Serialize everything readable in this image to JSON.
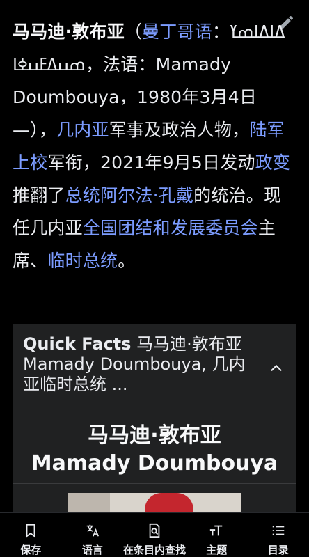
{
  "article": {
    "title": "马马迪·敦布亚",
    "p_open_paren": "（",
    "link_mandinka": "曼丁哥语",
    "p_mandinka_text": "：ߡߊߡߊߘߌ ߘߎߡߓߎߦߊ，法语：Mamady Doumbouya，1980年3月4日—），",
    "link_guinea": "几内亚",
    "p_text2": "军事及政治人物，",
    "link_colonel": "陆军上校",
    "p_text3": "军衔，2021年9月5日发动",
    "link_coup": "政变",
    "p_text4": "推翻了",
    "link_alpha_conde": "总统阿尔法·孔戴",
    "p_text5": "的统治。现任几内亚",
    "link_cnrd": "全国团结和发展委员会",
    "p_text6": "主席、",
    "link_interim": "临时总统",
    "p_end": "。"
  },
  "infobox": {
    "quick_facts": "Quick Facts",
    "summary": " 马马迪·敦布亚Mamady Doumbouya, 几内亚临时总统 ...",
    "name_cn": "马马迪·敦布亚",
    "name_latin": "Mamady Doumbouya"
  },
  "toolbar": {
    "items": [
      {
        "label": "保存",
        "icon": "bookmark-icon"
      },
      {
        "label": "语言",
        "icon": "translate-icon"
      },
      {
        "label": "在条目内查找",
        "icon": "find-in-page-icon"
      },
      {
        "label": "主题",
        "icon": "text-size-icon"
      },
      {
        "label": "目录",
        "icon": "contents-icon"
      }
    ]
  },
  "colors": {
    "background": "#000000",
    "text": "#eaecf0",
    "link": "#7c9cff",
    "infobox_bg": "#202122"
  }
}
